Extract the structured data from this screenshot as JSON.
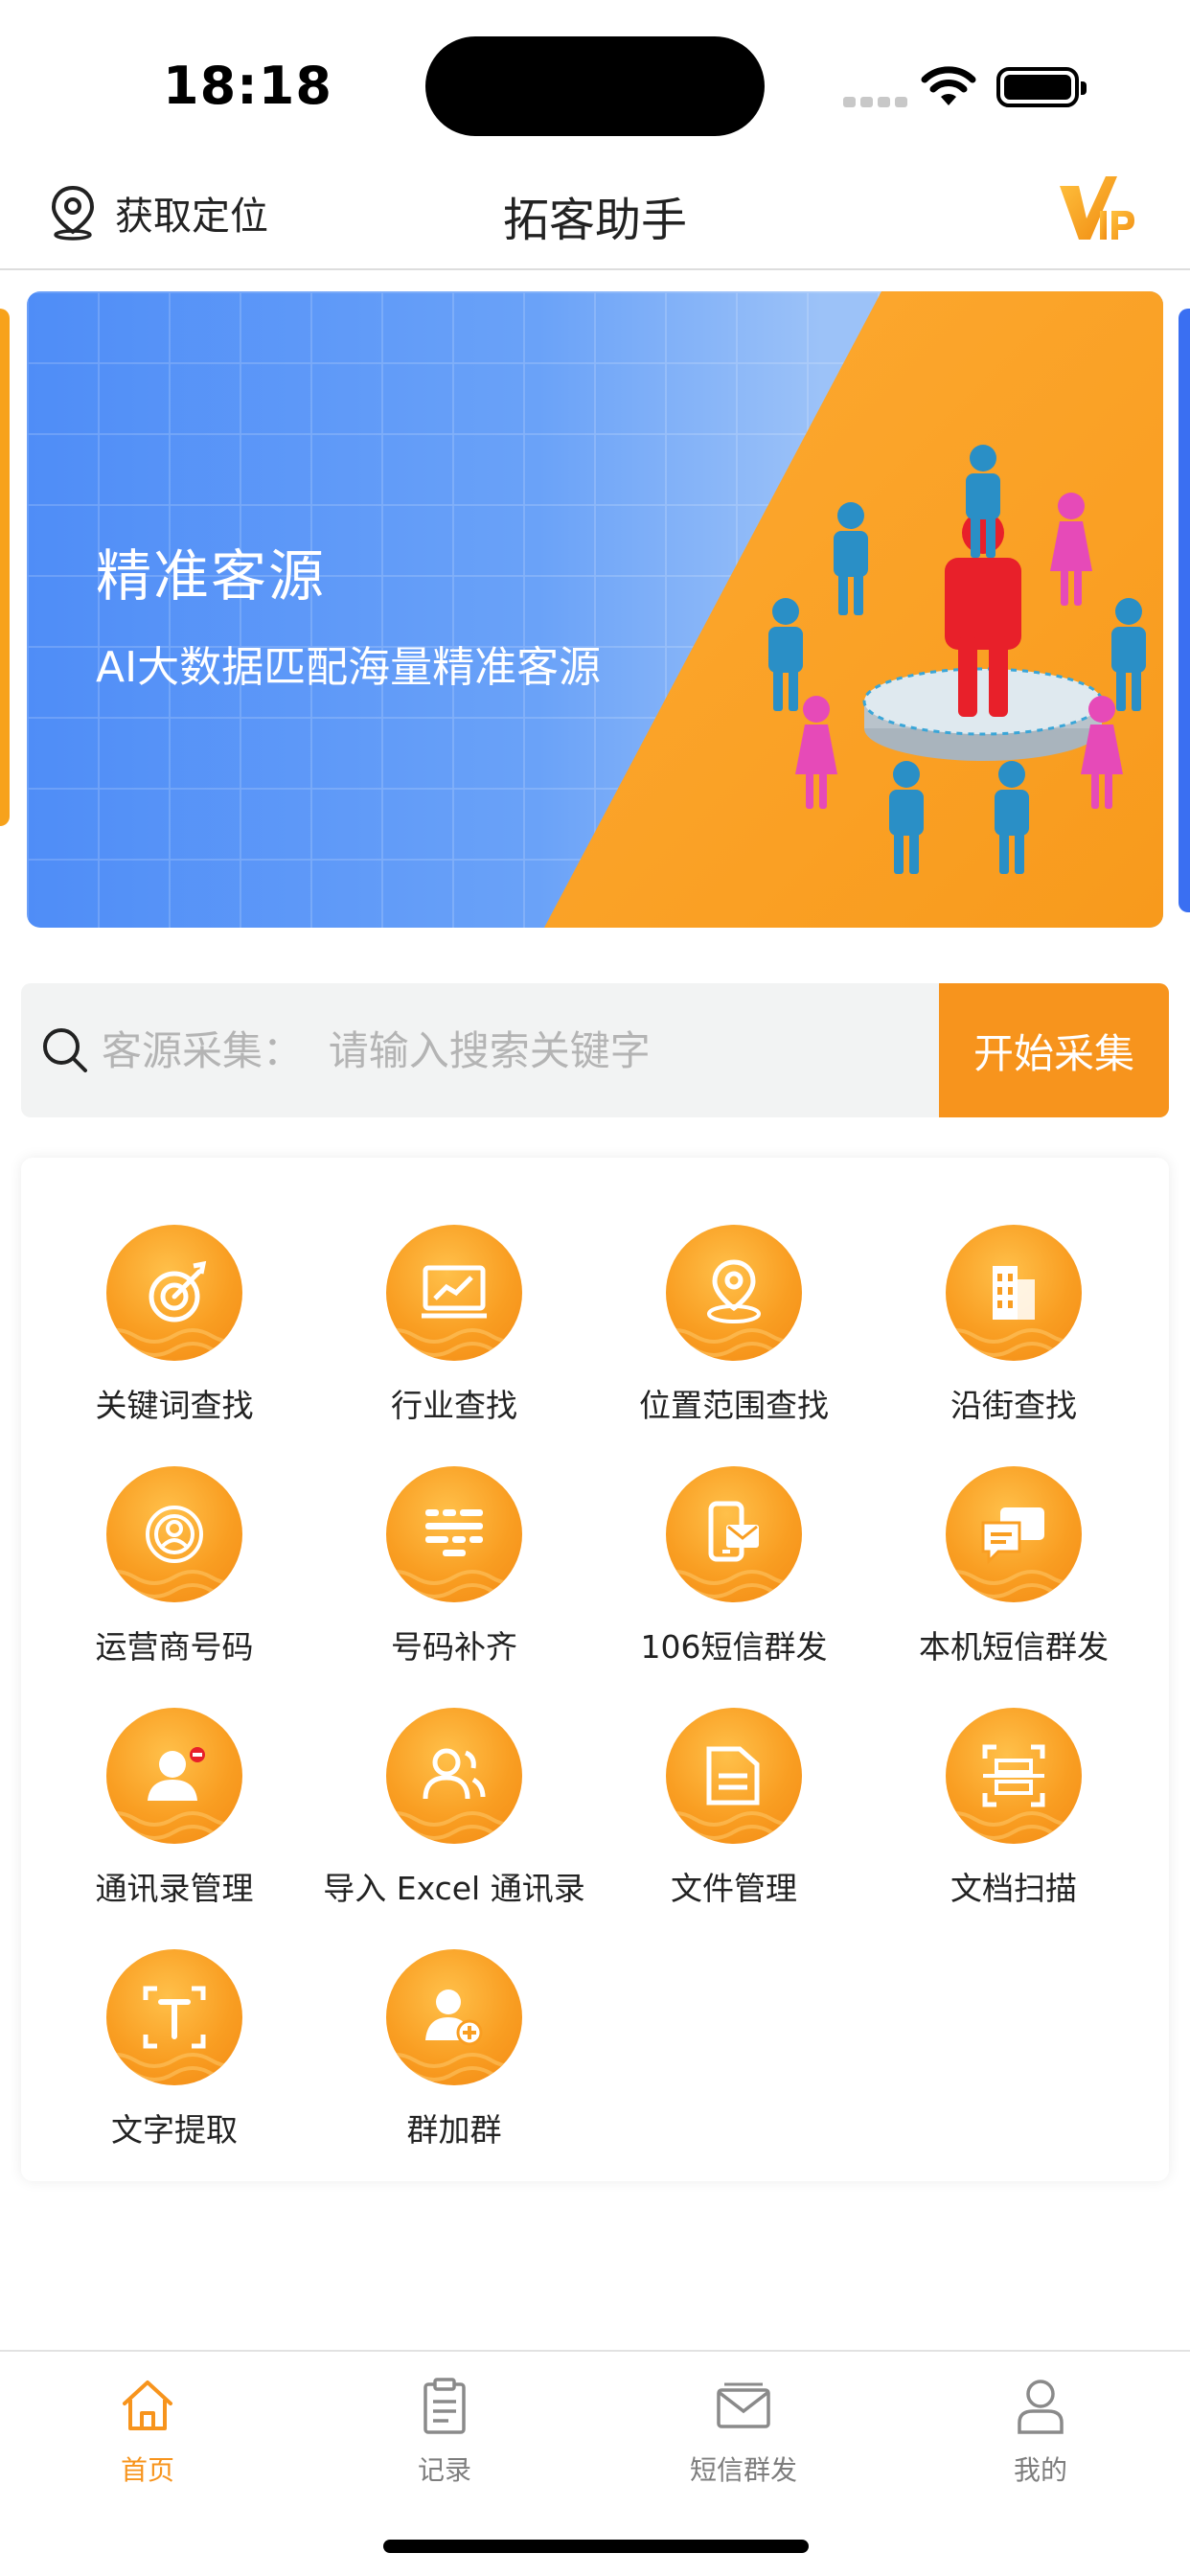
{
  "status_bar": {
    "time": "18:18"
  },
  "header": {
    "location_label": "获取定位",
    "title": "拓客助手",
    "vip_label": "VIP"
  },
  "banner": {
    "title": "精准客源",
    "subtitle": "AI大数据匹配海量精准客源",
    "page_count": 3,
    "active_page": 2
  },
  "search": {
    "placeholder": "客源采集：  请输入搜索关键字",
    "value": "",
    "button_label": "开始采集"
  },
  "features": [
    {
      "label": "关键词查找",
      "icon": "target-icon"
    },
    {
      "label": "行业查找",
      "icon": "chart-board-icon"
    },
    {
      "label": "位置范围查找",
      "icon": "map-pin-icon"
    },
    {
      "label": "沿街查找",
      "icon": "building-icon"
    },
    {
      "label": "运营商号码",
      "icon": "operator-icon"
    },
    {
      "label": "号码补齐",
      "icon": "number-list-icon"
    },
    {
      "label": "106短信群发",
      "icon": "phone-message-icon"
    },
    {
      "label": "本机短信群发",
      "icon": "chat-bubble-icon"
    },
    {
      "label": "通讯录管理",
      "icon": "contact-icon"
    },
    {
      "label": "导入 Excel 通讯录",
      "icon": "users-icon"
    },
    {
      "label": "文件管理",
      "icon": "folder-icon"
    },
    {
      "label": "文档扫描",
      "icon": "scan-icon"
    },
    {
      "label": "文字提取",
      "icon": "text-extract-icon"
    },
    {
      "label": "群加群",
      "icon": "add-user-icon"
    }
  ],
  "tabbar": {
    "tabs": [
      {
        "label": "首页",
        "icon": "home-icon",
        "active": true
      },
      {
        "label": "记录",
        "icon": "clipboard-icon",
        "active": false
      },
      {
        "label": "短信群发",
        "icon": "mail-icon",
        "active": false
      },
      {
        "label": "我的",
        "icon": "person-icon",
        "active": false
      }
    ]
  },
  "colors": {
    "accent": "#f7941d",
    "banner_blue": "#4f8df7",
    "inactive": "#7d7d7d"
  }
}
